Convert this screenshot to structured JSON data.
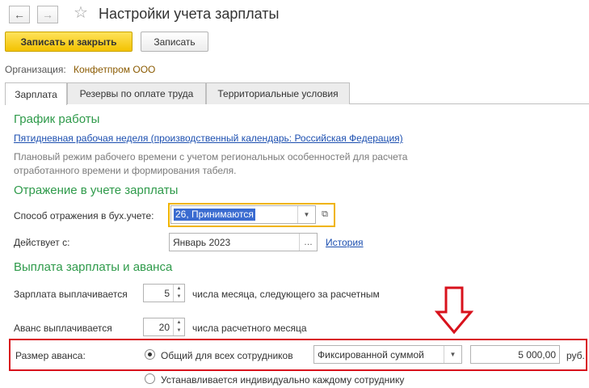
{
  "window": {
    "title": "Настройки учета зарплаты"
  },
  "toolbar": {
    "save_close_label": "Записать и закрыть",
    "save_label": "Записать"
  },
  "organization": {
    "label": "Организация:",
    "value": "Конфетпром ООО"
  },
  "tabs": [
    {
      "label": "Зарплата",
      "active": true
    },
    {
      "label": "Резервы по оплате труда",
      "active": false
    },
    {
      "label": "Территориальные условия",
      "active": false
    }
  ],
  "schedule": {
    "heading": "График работы",
    "link": "Пятидневная рабочая неделя (производственный календарь: Российская Федерация)",
    "hint_line1": "Плановый режим рабочего времени с учетом региональных особенностей для расчета",
    "hint_line2": "отработанного времени и формирования табеля."
  },
  "accounting": {
    "heading": "Отражение в учете зарплаты",
    "method_label": "Способ отражения в бух.учете:",
    "method_value": "26, Принимаются",
    "effective_label": "Действует с:",
    "effective_value": "Январь 2023",
    "history_link": "История"
  },
  "payment": {
    "heading": "Выплата зарплаты и аванса",
    "salary_label": "Зарплата выплачивается",
    "salary_day": "5",
    "salary_suffix": "числа месяца, следующего за расчетным",
    "advance_label": "Аванс выплачивается",
    "advance_day": "20",
    "advance_suffix": "числа расчетного месяца",
    "advance_size_label": "Размер аванса:",
    "option_common": "Общий для всех сотрудников",
    "option_individual": "Устанавливается индивидуально каждому сотруднику",
    "method_select": "Фиксированной суммой",
    "amount": "5 000,00",
    "currency": "руб."
  },
  "colors": {
    "accent_green": "#2e9a4a",
    "primary_button": "#f3c200",
    "link_blue": "#1c4fb0",
    "highlight_red": "#d8121c",
    "focus_yellow": "#f0b400"
  }
}
